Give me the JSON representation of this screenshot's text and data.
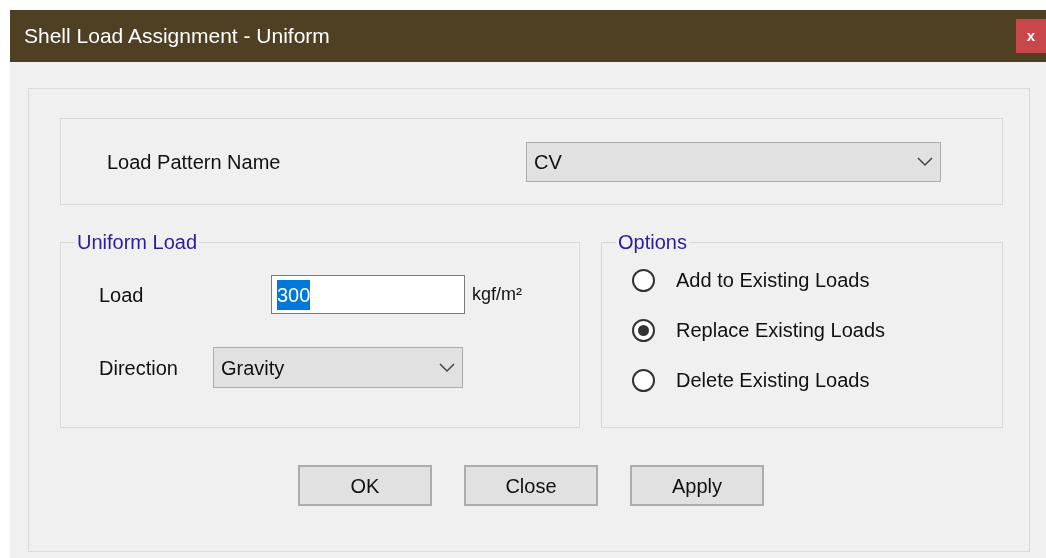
{
  "window": {
    "title": "Shell Load Assignment - Uniform",
    "close_label": "x"
  },
  "load_pattern": {
    "label": "Load Pattern Name",
    "value": "CV"
  },
  "uniform_load": {
    "title": "Uniform Load",
    "load_label": "Load",
    "load_value": "300",
    "load_value_selected": true,
    "unit": "kgf/m²",
    "direction_label": "Direction",
    "direction_value": "Gravity"
  },
  "options": {
    "title": "Options",
    "items": [
      {
        "label": "Add to Existing Loads",
        "selected": false
      },
      {
        "label": "Replace Existing Loads",
        "selected": true
      },
      {
        "label": "Delete Existing Loads",
        "selected": false
      }
    ]
  },
  "buttons": [
    "OK",
    "Close",
    "Apply"
  ]
}
